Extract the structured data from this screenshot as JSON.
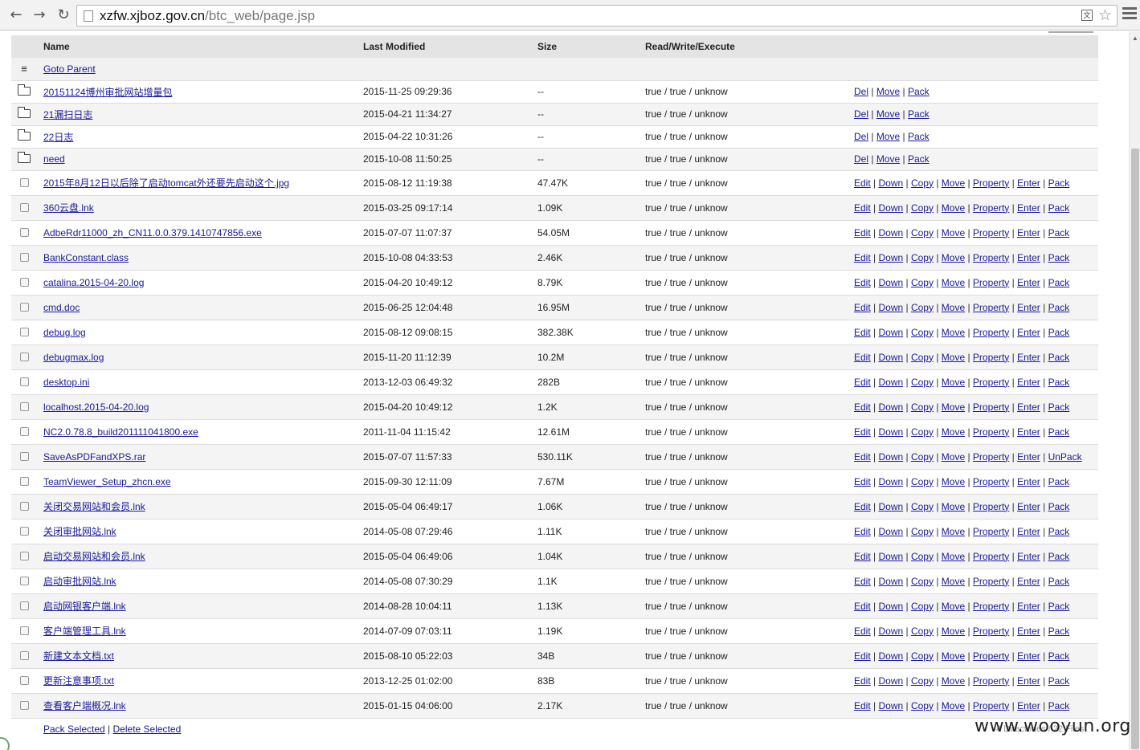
{
  "browser": {
    "url_host": "xzfw.xjboz.gov.cn",
    "url_path": "/btc_web/page.jsp",
    "translate_icon": "translate-icon",
    "star_icon": "star-icon",
    "menu_icon": "menu-icon"
  },
  "table": {
    "headers": {
      "name": "Name",
      "modified": "Last Modified",
      "size": "Size",
      "rwx": "Read/Write/Execute"
    },
    "goto_parent": "Goto Parent",
    "dirs": [
      {
        "name": "20151124博州审批网站增量包",
        "modified": "2015-11-25 09:29:36",
        "size": "--",
        "rwx": "true / true / unknow"
      },
      {
        "name": "21漏扫日志",
        "modified": "2015-04-21 11:34:27",
        "size": "--",
        "rwx": "true / true / unknow"
      },
      {
        "name": "22日志",
        "modified": "2015-04-22 10:31:26",
        "size": "--",
        "rwx": "true / true / unknow"
      },
      {
        "name": "need",
        "modified": "2015-10-08 11:50:25",
        "size": "--",
        "rwx": "true / true / unknow"
      }
    ],
    "dir_actions": [
      "Del",
      "Move",
      "Pack"
    ],
    "files": [
      {
        "name": "2015年8月12日以后除了启动tomcat外还要先启动这个.jpg",
        "modified": "2015-08-12 11:19:38",
        "size": "47.47K",
        "rwx": "true / true / unknow",
        "last_action": "Pack"
      },
      {
        "name": "360云盘.lnk",
        "modified": "2015-03-25 09:17:14",
        "size": "1.09K",
        "rwx": "true / true / unknow",
        "last_action": "Pack"
      },
      {
        "name": "AdbeRdr11000_zh_CN11.0.0.379.1410747856.exe",
        "modified": "2015-07-07 11:07:37",
        "size": "54.05M",
        "rwx": "true / true / unknow",
        "last_action": "Pack"
      },
      {
        "name": "BankConstant.class",
        "modified": "2015-10-08 04:33:53",
        "size": "2.46K",
        "rwx": "true / true / unknow",
        "last_action": "Pack"
      },
      {
        "name": "catalina.2015-04-20.log",
        "modified": "2015-04-20 10:49:12",
        "size": "8.79K",
        "rwx": "true / true / unknow",
        "last_action": "Pack"
      },
      {
        "name": "cmd.doc",
        "modified": "2015-06-25 12:04:48",
        "size": "16.95M",
        "rwx": "true / true / unknow",
        "last_action": "Pack"
      },
      {
        "name": "debug.log",
        "modified": "2015-08-12 09:08:15",
        "size": "382.38K",
        "rwx": "true / true / unknow",
        "last_action": "Pack"
      },
      {
        "name": "debugmax.log",
        "modified": "2015-11-20 11:12:39",
        "size": "10.2M",
        "rwx": "true / true / unknow",
        "last_action": "Pack"
      },
      {
        "name": "desktop.ini",
        "modified": "2013-12-03 06:49:32",
        "size": "282B",
        "rwx": "true / true / unknow",
        "last_action": "Pack"
      },
      {
        "name": "localhost.2015-04-20.log",
        "modified": "2015-04-20 10:49:12",
        "size": "1.2K",
        "rwx": "true / true / unknow",
        "last_action": "Pack"
      },
      {
        "name": "NC2.0.78.8_build201111041800.exe",
        "modified": "2011-11-04 11:15:42",
        "size": "12.61M",
        "rwx": "true / true / unknow",
        "last_action": "Pack"
      },
      {
        "name": "SaveAsPDFandXPS.rar",
        "modified": "2015-07-07 11:57:33",
        "size": "530.11K",
        "rwx": "true / true / unknow",
        "last_action": "UnPack"
      },
      {
        "name": "TeamViewer_Setup_zhcn.exe",
        "modified": "2015-09-30 12:11:09",
        "size": "7.67M",
        "rwx": "true / true / unknow",
        "last_action": "Pack"
      },
      {
        "name": "关闭交易网站和会员.lnk",
        "modified": "2015-05-04 06:49:17",
        "size": "1.06K",
        "rwx": "true / true / unknow",
        "last_action": "Pack"
      },
      {
        "name": "关闭审批网站.lnk",
        "modified": "2014-05-08 07:29:46",
        "size": "1.11K",
        "rwx": "true / true / unknow",
        "last_action": "Pack"
      },
      {
        "name": "启动交易网站和会员.lnk",
        "modified": "2015-05-04 06:49:06",
        "size": "1.04K",
        "rwx": "true / true / unknow",
        "last_action": "Pack"
      },
      {
        "name": "启动审批网站.lnk",
        "modified": "2014-05-08 07:30:29",
        "size": "1.1K",
        "rwx": "true / true / unknow",
        "last_action": "Pack"
      },
      {
        "name": "启动网银客户端.lnk",
        "modified": "2014-08-28 10:04:11",
        "size": "1.13K",
        "rwx": "true / true / unknow",
        "last_action": "Pack"
      },
      {
        "name": "客户端管理工具.lnk",
        "modified": "2014-07-09 07:03:11",
        "size": "1.19K",
        "rwx": "true / true / unknow",
        "last_action": "Pack"
      },
      {
        "name": "新建文本文档.txt",
        "modified": "2015-08-10 05:22:03",
        "size": "34B",
        "rwx": "true / true / unknow",
        "last_action": "Pack"
      },
      {
        "name": "更新注意事项.txt",
        "modified": "2013-12-25 01:02:00",
        "size": "83B",
        "rwx": "true / true / unknow",
        "last_action": "Pack"
      },
      {
        "name": "查看客户端概况.lnk",
        "modified": "2015-01-15 04:06:00",
        "size": "2.17K",
        "rwx": "true / true / unknow",
        "last_action": "Pack"
      }
    ],
    "file_actions": [
      "Edit",
      "Down",
      "Copy",
      "Move",
      "Property",
      "Enter"
    ],
    "footer": {
      "pack_selected": "Pack Selected",
      "delete_selected": "Delete Selected"
    }
  },
  "watermark": "www.wooyun.org",
  "status_faint": "4 Directories / 22 Files"
}
